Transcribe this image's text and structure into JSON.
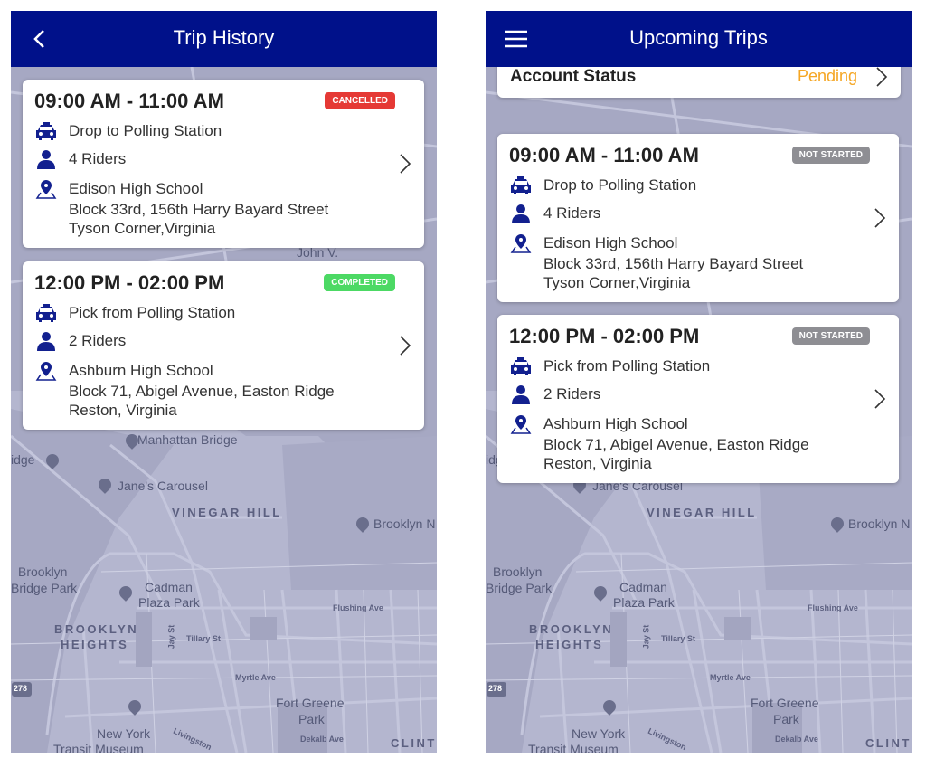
{
  "colors": {
    "header": "#00118a",
    "icon": "#12208f",
    "cancelled": "#e53935",
    "completed": "#4cd964",
    "not_started": "#8e8e93",
    "pending": "#f5a623"
  },
  "map_labels": {
    "manhattan_bridge": "Manhattan Bridge",
    "bridge_partial": "idge",
    "janes_carousel": "Jane's Carousel",
    "vinegar_hill": "VINEGAR HILL",
    "brooklyn_n": "Brooklyn N",
    "brooklyn": "Brooklyn",
    "bridge_park": "Bridge Park",
    "cadman": "Cadman",
    "plaza_park": "Plaza Park",
    "brooklyn_caps": "BROOKLYN",
    "heights": "HEIGHTS",
    "flushing_ave": "Flushing Ave",
    "tillary_st": "Tillary St",
    "jay_st": "Jay St",
    "myrtle_ave": "Myrtle Ave",
    "fort_greene": "Fort Greene",
    "park": "Park",
    "new_york": "New York",
    "transit_museum": "Transit Museum",
    "dekalb_ave": "Dekalb Ave",
    "clint": "CLINT",
    "livingston": "Livingston",
    "route": "278",
    "john_v": "John V."
  },
  "history": {
    "title": "Trip History",
    "back_icon": "chevron-left-icon",
    "trips": [
      {
        "time": "09:00 AM - 11:00 AM",
        "status": "CANCELLED",
        "type": "Drop to Polling Station",
        "riders": "4 Riders",
        "place": "Edison High School",
        "address1": "Block 33rd, 156th Harry Bayard Street",
        "address2": "Tyson Corner,Virginia"
      },
      {
        "time": "12:00 PM - 02:00 PM",
        "status": "COMPLETED",
        "type": "Pick from Polling Station",
        "riders": "2 Riders",
        "place": "Ashburn High School",
        "address1": "Block 71, Abigel Avenue, Easton Ridge",
        "address2": "Reston, Virginia"
      }
    ]
  },
  "upcoming": {
    "title": "Upcoming Trips",
    "menu_icon": "hamburger-menu-icon",
    "account_status": {
      "label": "Account Status",
      "value": "Pending"
    },
    "trips": [
      {
        "time": "09:00 AM - 11:00 AM",
        "status": "NOT STARTED",
        "type": "Drop to Polling Station",
        "riders": "4 Riders",
        "place": "Edison High School",
        "address1": "Block 33rd, 156th Harry Bayard Street",
        "address2": "Tyson Corner,Virginia"
      },
      {
        "time": "12:00 PM - 02:00 PM",
        "status": "NOT STARTED",
        "type": "Pick from Polling Station",
        "riders": "2 Riders",
        "place": "Ashburn High School",
        "address1": "Block 71, Abigel Avenue, Easton Ridge",
        "address2": "Reston, Virginia"
      }
    ]
  }
}
